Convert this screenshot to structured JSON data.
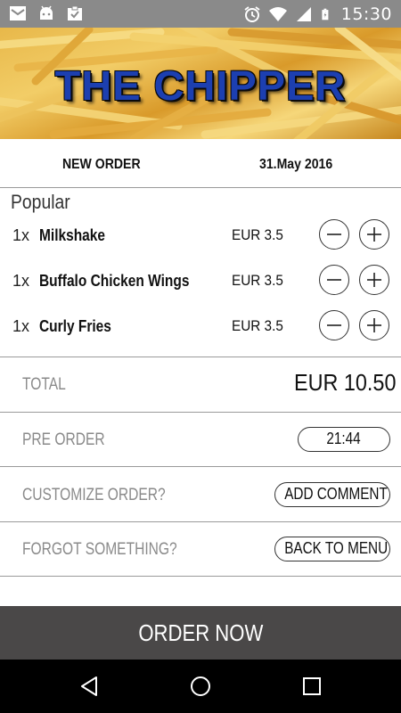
{
  "status_bar": {
    "time": "15:30",
    "left_icons": [
      "mail-icon",
      "android-icon",
      "clipboard-check-icon"
    ],
    "right_icons": [
      "alarm-icon",
      "wifi-icon",
      "signal-icon",
      "battery-charging-icon"
    ]
  },
  "banner": {
    "title": "THE CHIPPER"
  },
  "order_header": {
    "label": "NEW ORDER",
    "date": "31.May 2016"
  },
  "section": {
    "title": "Popular"
  },
  "items": [
    {
      "qty": "1x",
      "name": "Milkshake",
      "price": "EUR 3.5"
    },
    {
      "qty": "1x",
      "name": "Buffalo Chicken Wings",
      "price": "EUR 3.5"
    },
    {
      "qty": "1x",
      "name": "Curly Fries",
      "price": "EUR 3.5"
    }
  ],
  "total": {
    "label": "TOTAL",
    "value": "EUR 10.50"
  },
  "pre_order": {
    "label": "PRE ORDER",
    "time": "21:44"
  },
  "customize": {
    "label": "CUSTOMIZE ORDER?",
    "button": "ADD COMMENT"
  },
  "forgot": {
    "label": "FORGOT SOMETHING?",
    "button": "BACK TO MENU"
  },
  "order_button": "ORDER NOW",
  "colors": {
    "status_bar": "#8a8a8a",
    "title_blue": "#1c3fb0",
    "order_button_bg": "#4a4848",
    "nav_bar": "#000000",
    "muted_label": "#8a8a8a"
  }
}
